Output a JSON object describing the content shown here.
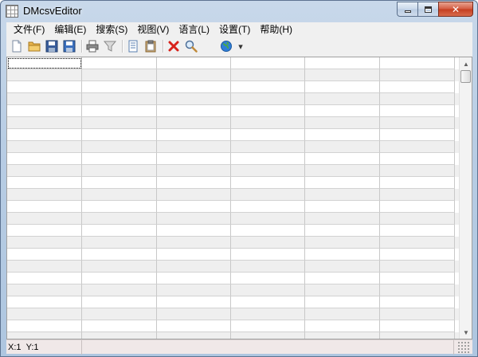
{
  "window": {
    "title": "DMcsvEditor",
    "close_glyph": "✕"
  },
  "menu": [
    {
      "label": "文件(F)"
    },
    {
      "label": "编辑(E)"
    },
    {
      "label": "搜索(S)"
    },
    {
      "label": "视图(V)"
    },
    {
      "label": "语言(L)"
    },
    {
      "label": "设置(T)"
    },
    {
      "label": "帮助(H)"
    }
  ],
  "toolbar": {
    "icons": [
      "new-file-icon",
      "open-folder-icon",
      "save-icon",
      "save-as-icon",
      "print-icon",
      "filter-icon",
      "copy-icon",
      "paste-icon",
      "delete-icon",
      "search-icon",
      "globe-language-icon",
      "dropdown-arrow-icon"
    ],
    "dropdown_glyph": "▾"
  },
  "grid": {
    "columns": 6,
    "rows": 24,
    "focused_cell": {
      "row": 1,
      "col": 1
    }
  },
  "scrollbar": {
    "up_glyph": "▲",
    "down_glyph": "▼"
  },
  "status": {
    "x_label": "X:1",
    "y_label": "Y:1"
  },
  "colors": {
    "titlebar": "#b8cde4",
    "close_button": "#c43d1f",
    "alt_row": "#efefef",
    "statusbar": "#f0e8e8"
  }
}
